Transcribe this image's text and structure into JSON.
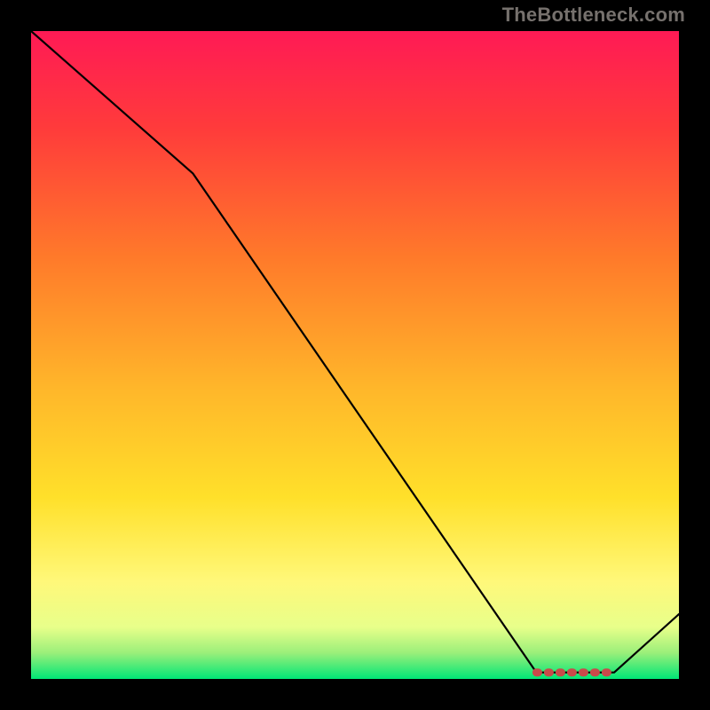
{
  "attribution": "TheBottleneck.com",
  "chart_data": {
    "type": "line",
    "title": "",
    "xlabel": "",
    "ylabel": "",
    "xlim": [
      0,
      100
    ],
    "ylim": [
      0,
      100
    ],
    "x": [
      0,
      25,
      78,
      90,
      100
    ],
    "values": [
      100,
      78,
      1,
      1,
      10
    ],
    "series": [
      {
        "name": "bottleneck-curve",
        "x": [
          0,
          25,
          78,
          90,
          100
        ],
        "values": [
          100,
          78,
          1,
          1,
          10
        ]
      },
      {
        "name": "optimal-region-marker",
        "x": [
          78,
          90
        ],
        "values": [
          1,
          1
        ]
      }
    ],
    "gradient_stops": [
      {
        "pct": 0,
        "color": "#ff1a55"
      },
      {
        "pct": 15,
        "color": "#ff3b3b"
      },
      {
        "pct": 35,
        "color": "#ff7a2a"
      },
      {
        "pct": 55,
        "color": "#ffb62a"
      },
      {
        "pct": 72,
        "color": "#ffe02a"
      },
      {
        "pct": 85,
        "color": "#fff87a"
      },
      {
        "pct": 92,
        "color": "#e8ff8a"
      },
      {
        "pct": 96,
        "color": "#9aef7a"
      },
      {
        "pct": 100,
        "color": "#00e676"
      }
    ]
  }
}
